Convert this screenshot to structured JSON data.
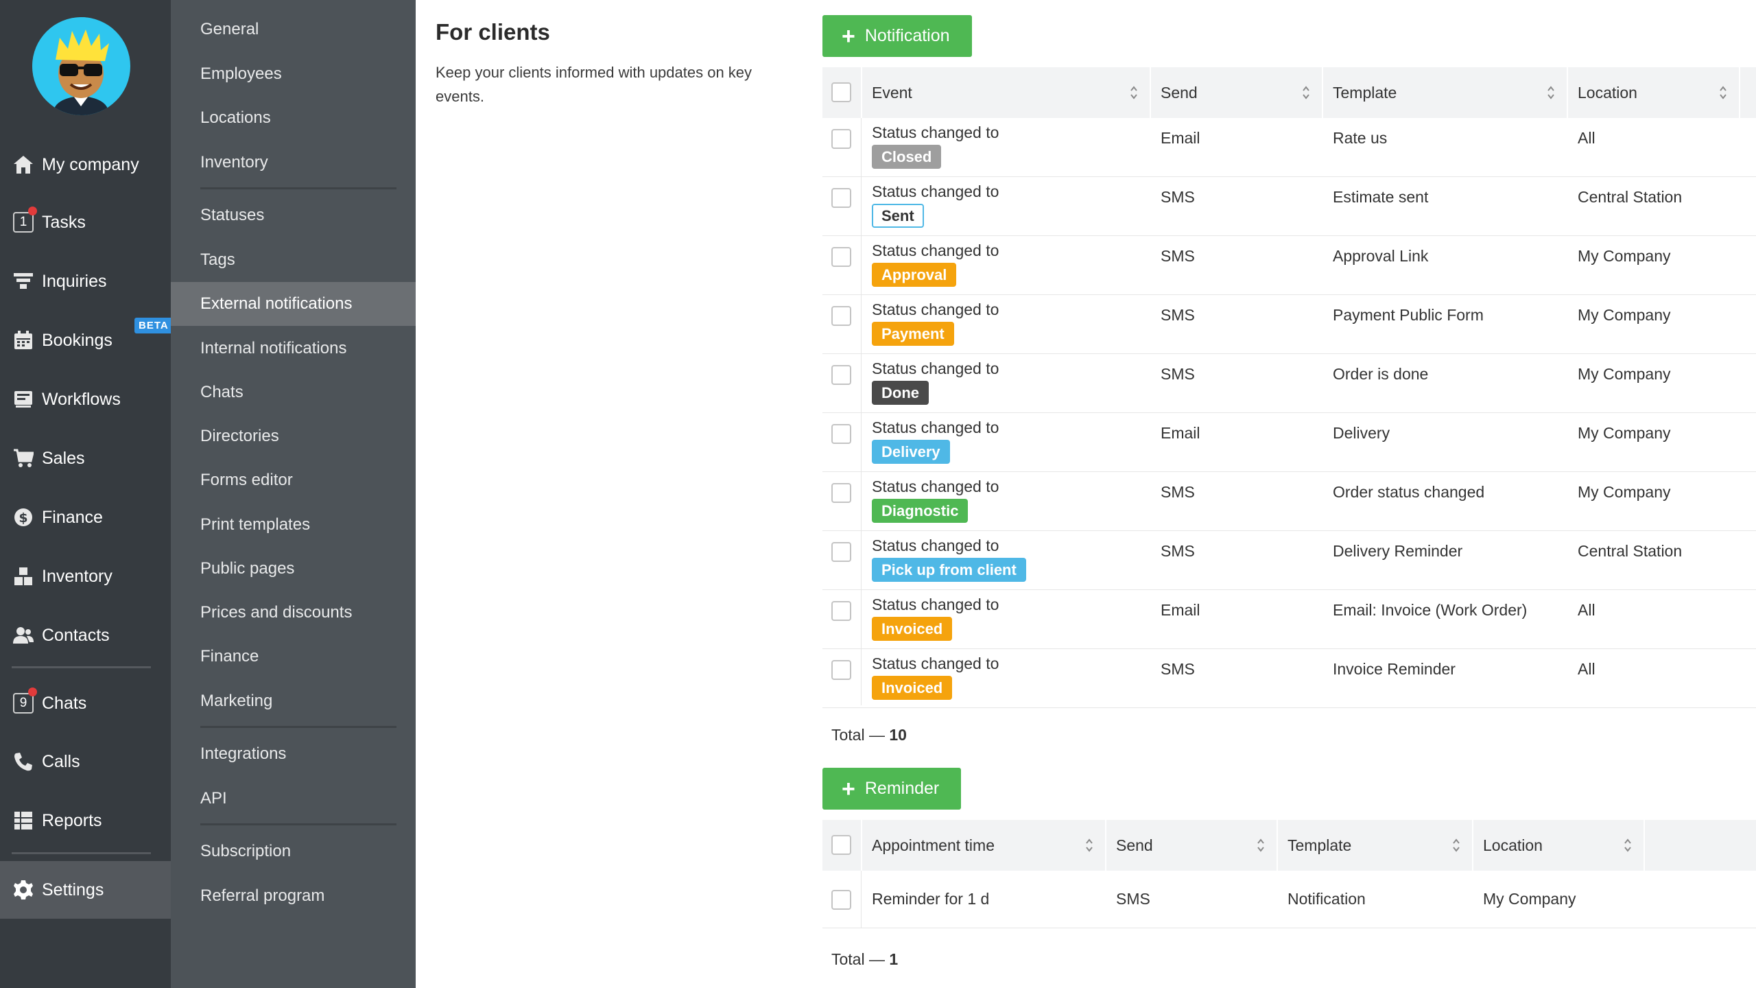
{
  "nav": {
    "items": [
      {
        "label": "My company",
        "icon": "home-icon"
      },
      {
        "label": "Tasks",
        "icon": "tasks-icon",
        "badge": "1"
      },
      {
        "label": "Inquiries",
        "icon": "funnel-icon"
      },
      {
        "label": "Bookings",
        "icon": "calendar-icon",
        "beta": "BETA"
      },
      {
        "label": "Workflows",
        "icon": "workflow-icon"
      },
      {
        "label": "Sales",
        "icon": "cart-icon"
      },
      {
        "label": "Finance",
        "icon": "dollar-icon"
      },
      {
        "label": "Inventory",
        "icon": "boxes-icon"
      },
      {
        "label": "Contacts",
        "icon": "users-icon"
      },
      {
        "label": "Chats",
        "icon": "chat-icon",
        "badge": "9"
      },
      {
        "label": "Calls",
        "icon": "phone-icon"
      },
      {
        "label": "Reports",
        "icon": "reports-icon"
      },
      {
        "label": "Settings",
        "icon": "gear-icon"
      }
    ]
  },
  "subnav": {
    "items": [
      "General",
      "Employees",
      "Locations",
      "Inventory",
      "Statuses",
      "Tags",
      "External notifications",
      "Internal notifications",
      "Chats",
      "Directories",
      "Forms editor",
      "Print templates",
      "Public pages",
      "Prices and discounts",
      "Finance",
      "Marketing",
      "Integrations",
      "API",
      "Subscription",
      "Referral program"
    ]
  },
  "page": {
    "title": "For clients",
    "description": "Keep your clients informed with updates on key events."
  },
  "notifications": {
    "add_button": "Notification",
    "columns": [
      "Event",
      "Send",
      "Template",
      "Location"
    ],
    "event_prefix": "Status changed to",
    "rows": [
      {
        "status": "Closed",
        "status_color": "#9e9e9e",
        "send": "Email",
        "template": "Rate us",
        "location": "All"
      },
      {
        "status": "Sent",
        "status_color": "#ffffff",
        "send": "SMS",
        "template": "Estimate sent",
        "location": "Central Station"
      },
      {
        "status": "Approval",
        "status_color": "#f5a30d",
        "send": "SMS",
        "template": "Approval Link",
        "location": "My Company"
      },
      {
        "status": "Payment",
        "status_color": "#f5a30d",
        "send": "SMS",
        "template": "Payment Public Form",
        "location": "My Company"
      },
      {
        "status": "Done",
        "status_color": "#4a4a4a",
        "send": "SMS",
        "template": "Order is done",
        "location": "My Company"
      },
      {
        "status": "Delivery",
        "status_color": "#4fb8e6",
        "send": "Email",
        "template": "Delivery",
        "location": "My Company"
      },
      {
        "status": "Diagnostic",
        "status_color": "#4fb853",
        "send": "SMS",
        "template": "Order status changed",
        "location": "My Company"
      },
      {
        "status": "Pick up from client",
        "status_color": "#4fb8e6",
        "send": "SMS",
        "template": "Delivery Reminder",
        "location": "Central Station"
      },
      {
        "status": "Invoiced",
        "status_color": "#f5a30d",
        "send": "Email",
        "template": "Email: Invoice (Work Order)",
        "location": "All"
      },
      {
        "status": "Invoiced",
        "status_color": "#f5a30d",
        "send": "SMS",
        "template": "Invoice Reminder",
        "location": "All"
      }
    ],
    "total_label": "Total —",
    "total_value": "10"
  },
  "reminders": {
    "add_button": "Reminder",
    "columns": [
      "Appointment time",
      "Send",
      "Template",
      "Location"
    ],
    "rows": [
      {
        "time": "Reminder for 1 d",
        "send": "SMS",
        "template": "Notification",
        "location": "My Company"
      }
    ],
    "total_label": "Total —",
    "total_value": "1"
  },
  "colors": {
    "nav_bg": "#363b40",
    "subnav_bg": "#4d5358",
    "accent_green": "#4fb853",
    "beta_blue": "#2f90e0",
    "badge_red": "#e23b3b"
  }
}
